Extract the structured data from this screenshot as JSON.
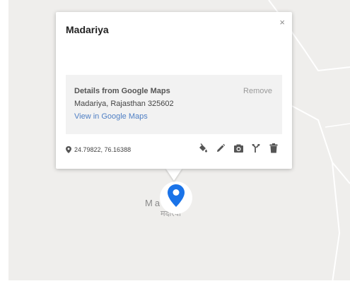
{
  "info_window": {
    "title": "Madariya",
    "close_glyph": "×",
    "details": {
      "heading": "Details from Google Maps",
      "remove_label": "Remove",
      "address": "Madariya, Rajasthan 325602",
      "view_link": "View in Google Maps"
    },
    "coordinates": "24.79822, 76.16388",
    "tools": [
      {
        "icon": "paint-bucket-icon"
      },
      {
        "icon": "pencil-icon"
      },
      {
        "icon": "camera-icon"
      },
      {
        "icon": "directions-fork-icon"
      },
      {
        "icon": "trash-icon"
      }
    ]
  },
  "map": {
    "place_label_latin": "Ma    ya",
    "place_label_devanagari": "मदारया",
    "marker_color": "#1a73e8",
    "background_color": "#efeeec"
  }
}
